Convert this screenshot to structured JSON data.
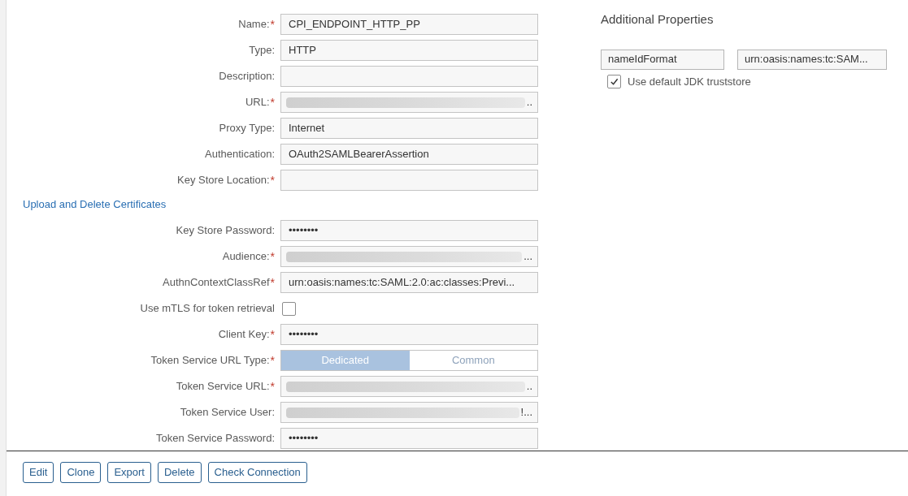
{
  "form": {
    "rows": [
      {
        "kind": "text",
        "label": "Name:",
        "required_mark": "*",
        "value": "CPI_ENDPOINT_HTTP_PP"
      },
      {
        "kind": "text",
        "label": "Type:",
        "value": "HTTP"
      },
      {
        "kind": "text",
        "label": "Description:"
      },
      {
        "kind": "blurred",
        "label": "URL:",
        "required_mark": "*",
        "value": ".."
      },
      {
        "kind": "text",
        "label": "Proxy Type:",
        "value": "Internet"
      },
      {
        "kind": "text",
        "label": "Authentication:",
        "value": "OAuth2SAMLBearerAssertion"
      },
      {
        "kind": "text",
        "label": "Key Store Location:",
        "required_mark": "*"
      },
      {
        "kind": "link",
        "label": "Upload and Delete Certificates"
      },
      {
        "kind": "text",
        "label": "Key Store Password:",
        "value": "••••••••"
      },
      {
        "kind": "blurred",
        "label": "Audience:",
        "required_mark": "*",
        "value": "..."
      },
      {
        "kind": "text",
        "label": "AuthnContextClassRef",
        "required_mark": "*",
        "value": "urn:oasis:names:tc:SAML:2.0:ac:classes:Previ..."
      },
      {
        "kind": "checkbox",
        "label": "Use mTLS for token retrieval",
        "checked": false
      },
      {
        "kind": "text",
        "label": "Client Key:",
        "required_mark": "*",
        "value": "••••••••"
      },
      {
        "kind": "segmented",
        "label": "Token Service URL Type:",
        "required_mark": "*",
        "options": [
          {
            "label": "Dedicated",
            "selected": true
          },
          {
            "label": "Common",
            "selected": false
          }
        ]
      },
      {
        "kind": "blurred",
        "label": "Token Service URL:",
        "required_mark": "*",
        "value": ".."
      },
      {
        "kind": "blurred",
        "label": "Token Service User:",
        "value": "!..."
      },
      {
        "kind": "text",
        "label": "Token Service Password:",
        "value": "••••••••"
      }
    ]
  },
  "additional_properties": {
    "title": "Additional Properties",
    "key": "nameIdFormat",
    "value": "urn:oasis:names:tc:SAM...",
    "truststore": {
      "label": "Use default JDK truststore",
      "checked": true
    }
  },
  "buttons": [
    "Edit",
    "Clone",
    "Export",
    "Delete",
    "Check Connection"
  ]
}
